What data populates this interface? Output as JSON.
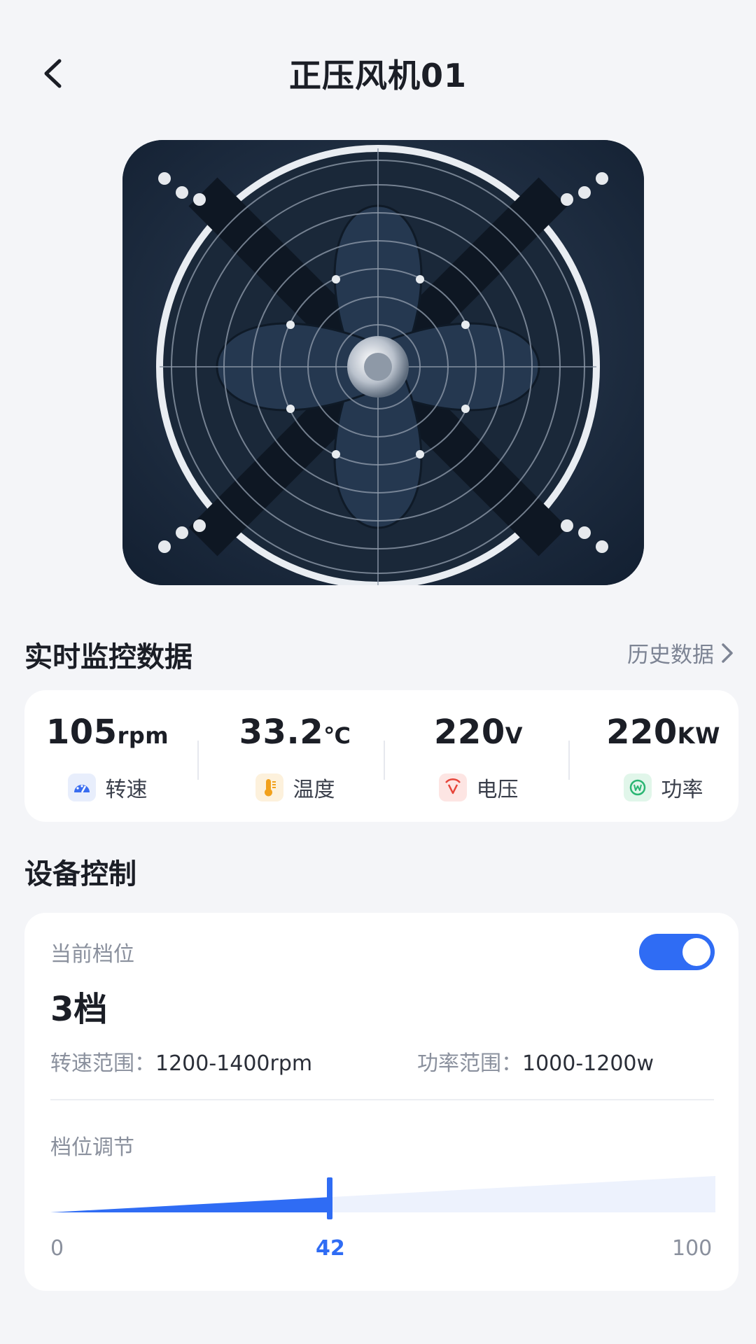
{
  "header": {
    "title": "正压风机01"
  },
  "fan_image": {
    "alt": "fan-photo"
  },
  "monitor": {
    "title": "实时监控数据",
    "history_label": "历史数据",
    "metrics": [
      {
        "value": "105",
        "unit": "rpm",
        "label": "转速",
        "icon": "speedometer-icon",
        "color": "#3a6df0",
        "bg": "#e8eefc"
      },
      {
        "value": "33.2",
        "unit": "℃",
        "label": "温度",
        "icon": "thermometer-icon",
        "color": "#f2a11c",
        "bg": "#fdf1dc"
      },
      {
        "value": "220",
        "unit": "V",
        "label": "电压",
        "icon": "voltage-icon",
        "color": "#e6453a",
        "bg": "#fde5e3"
      },
      {
        "value": "220",
        "unit": "KW",
        "label": "功率",
        "icon": "power-icon",
        "color": "#2bb673",
        "bg": "#e1f6ea"
      }
    ]
  },
  "control": {
    "title": "设备控制",
    "current_gear_label": "当前档位",
    "current_gear": "3档",
    "power_on": true,
    "speed_range_label": "转速范围：",
    "speed_range": "1200-1400rpm",
    "power_range_label": "功率范围：",
    "power_range": "1000-1200w",
    "adjust_label": "档位调节",
    "slider": {
      "min": "0",
      "max": "100",
      "value": "42",
      "level": 42
    }
  },
  "colors": {
    "accent": "#2f6cf4",
    "track": "#edf2fd"
  }
}
